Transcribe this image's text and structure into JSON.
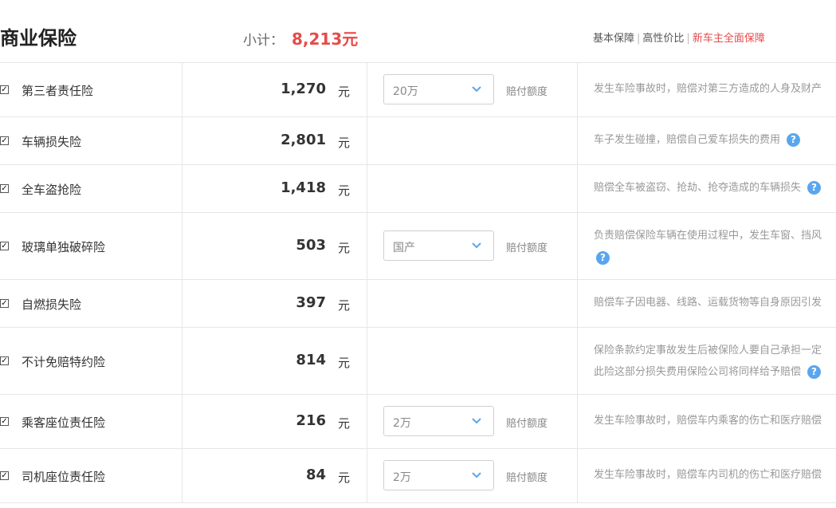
{
  "header": {
    "title": "商业保险",
    "subtotal_label": "小计：",
    "subtotal_value": "8,213元",
    "tiers": [
      "基本保障",
      "高性价比",
      "新车主全面保障"
    ]
  },
  "colors": {
    "accent": "#e64a4a",
    "help": "#5aa6ee"
  },
  "rows": [
    {
      "name": "第三者责任险",
      "price": "1,270",
      "unit": "元",
      "select": "20万",
      "select_label": "赔付额度",
      "desc": "发生车险事故时，赔偿对第三方造成的人身及财产"
    },
    {
      "name": "车辆损失险",
      "price": "2,801",
      "unit": "元",
      "desc": "车子发生碰撞，赔偿自己爱车损失的费用"
    },
    {
      "name": "全车盗抢险",
      "price": "1,418",
      "unit": "元",
      "desc": "赔偿全车被盗窃、抢劫、抢夺造成的车辆损失"
    },
    {
      "name": "玻璃单独破碎险",
      "price": "503",
      "unit": "元",
      "select": "国产",
      "select_label": "赔付额度",
      "desc": "负责赔偿保险车辆在使用过程中，发生车窗、挡风"
    },
    {
      "name": "自燃损失险",
      "price": "397",
      "unit": "元",
      "desc": "赔偿车子因电器、线路、运载货物等自身原因引发"
    },
    {
      "name": "不计免赔特约险",
      "price": "814",
      "unit": "元",
      "desc": "保险条款约定事故发生后被保险人要自己承担一定",
      "desc2": "此险这部分损失费用保险公司将同样给予赔偿"
    },
    {
      "name": "乘客座位责任险",
      "price": "216",
      "unit": "元",
      "select": "2万",
      "select_label": "赔付额度",
      "desc": "发生车险事故时，赔偿车内乘客的伤亡和医疗赔偿"
    },
    {
      "name": "司机座位责任险",
      "price": "84",
      "unit": "元",
      "select": "2万",
      "select_label": "赔付额度",
      "desc": "发生车险事故时，赔偿车内司机的伤亡和医疗赔偿"
    }
  ]
}
